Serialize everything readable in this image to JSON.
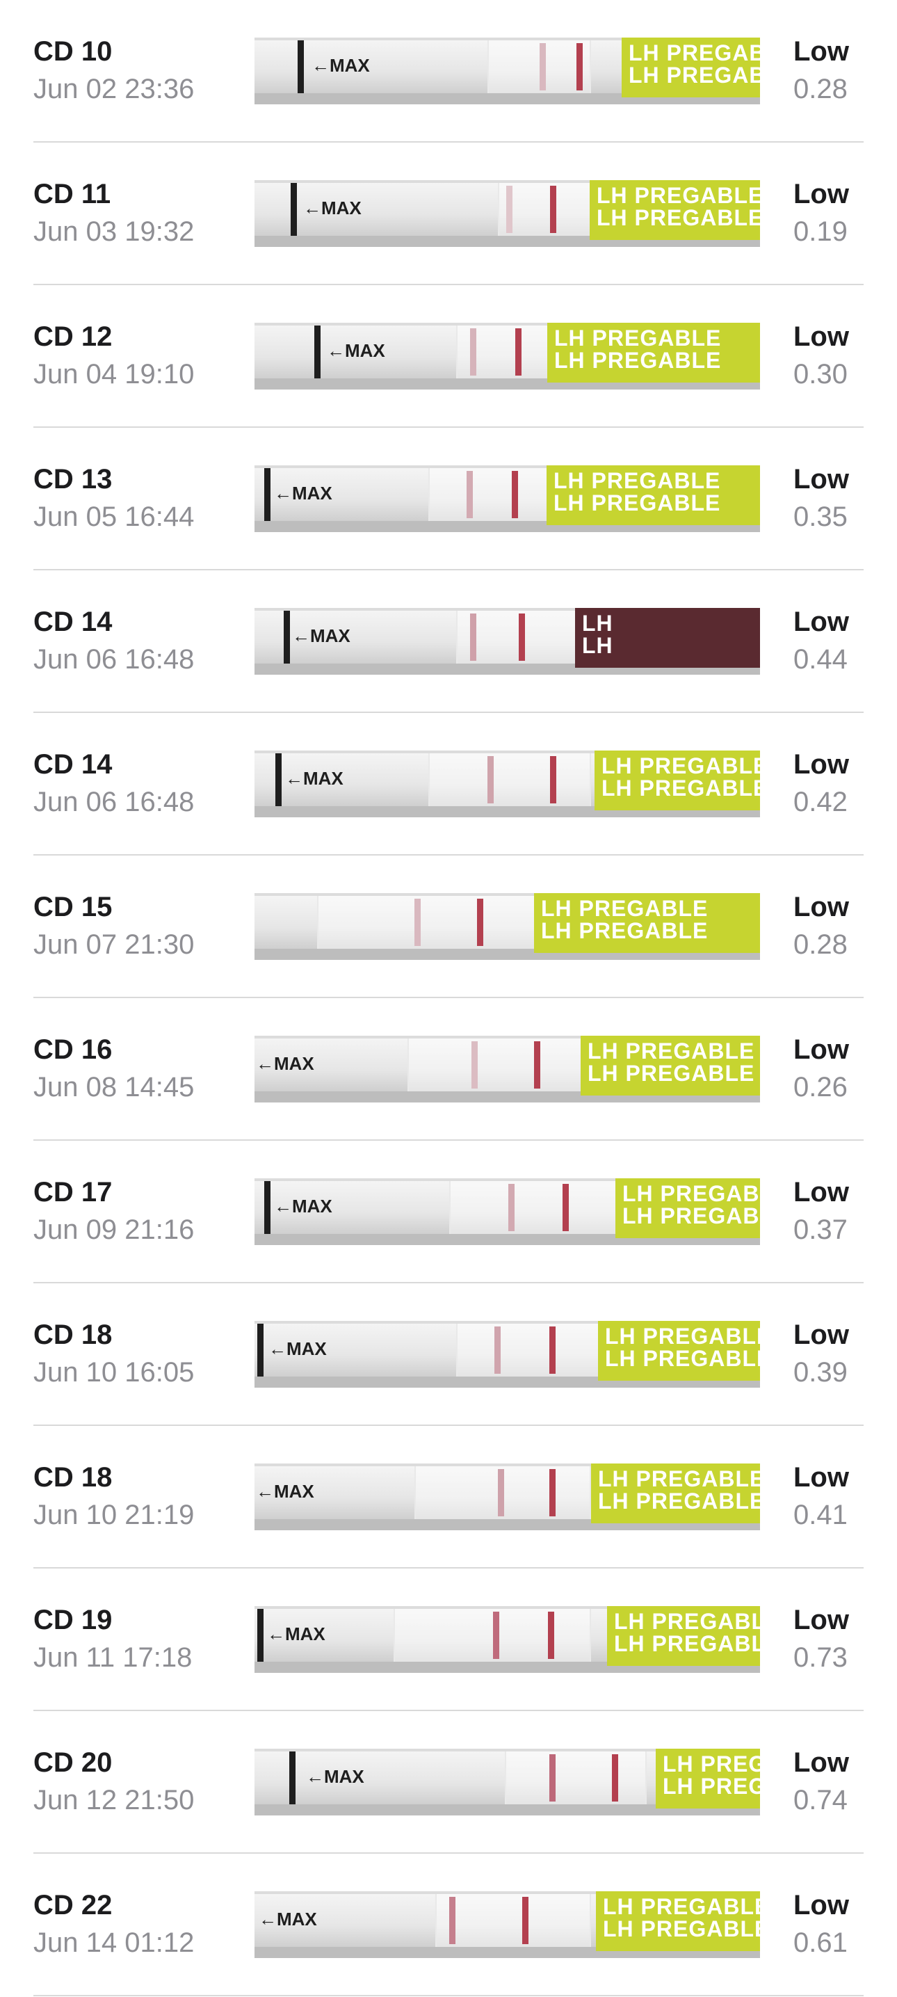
{
  "entries": [
    {
      "cd": "CD 10",
      "time": "Jun 02 23:36",
      "level": "Low",
      "ratio": "0.28",
      "strip": {
        "max": "←MAX",
        "brand": "LH PREGABLE",
        "brand_color": "#c6d430",
        "control": "#b3404f",
        "test": "#d9b8bf",
        "test_strength": 0.3
      }
    },
    {
      "cd": "CD 11",
      "time": "Jun 03 19:32",
      "level": "Low",
      "ratio": "0.19",
      "strip": {
        "max": "←MAX",
        "brand": "LH PREGABLE",
        "brand_color": "#c6d430",
        "control": "#b3404f",
        "test": "#e0c6cb",
        "test_strength": 0.2
      }
    },
    {
      "cd": "CD 12",
      "time": "Jun 04 19:10",
      "level": "Low",
      "ratio": "0.30",
      "strip": {
        "max": "←MAX",
        "brand": "LH PREGABLE",
        "brand_color": "#c6d430",
        "control": "#b3404f",
        "test": "#d6b3ba",
        "test_strength": 0.3
      }
    },
    {
      "cd": "CD 13",
      "time": "Jun 05 16:44",
      "level": "Low",
      "ratio": "0.35",
      "strip": {
        "max": "←MAX",
        "brand": "LH PREGABLE",
        "brand_color": "#c6d430",
        "control": "#b3404f",
        "test": "#d3aab2",
        "test_strength": 0.35
      }
    },
    {
      "cd": "CD 14",
      "time": "Jun 06 16:48",
      "level": "Low",
      "ratio": "0.44",
      "strip": {
        "max": "←MAX",
        "brand": "LH",
        "brand_color": "#5a2a30",
        "control": "#b3404f",
        "test": "#cfa0a9",
        "test_strength": 0.44
      }
    },
    {
      "cd": "CD 14",
      "time": "Jun 06 16:48",
      "level": "Low",
      "ratio": "0.42",
      "strip": {
        "max": "←MAX",
        "brand": "LH PREGABLE",
        "brand_color": "#c6d430",
        "control": "#b3404f",
        "test": "#cfa3ab",
        "test_strength": 0.42
      }
    },
    {
      "cd": "CD 15",
      "time": "Jun 07 21:30",
      "level": "Low",
      "ratio": "0.28",
      "strip": {
        "max": "",
        "brand": "LH PREGABLE",
        "brand_color": "#c6d430",
        "control": "#b3404f",
        "test": "#d9b8bf",
        "test_strength": 0.28
      }
    },
    {
      "cd": "CD 16",
      "time": "Jun 08 14:45",
      "level": "Low",
      "ratio": "0.26",
      "strip": {
        "max": "←MAX",
        "brand": "LH PREGABLE",
        "brand_color": "#c6d430",
        "control": "#b3404f",
        "test": "#dbbcc2",
        "test_strength": 0.26
      }
    },
    {
      "cd": "CD 17",
      "time": "Jun 09 21:16",
      "level": "Low",
      "ratio": "0.37",
      "strip": {
        "max": "←MAX",
        "brand": "LH PREGABLE",
        "brand_color": "#c6d430",
        "control": "#b3404f",
        "test": "#d2a9b1",
        "test_strength": 0.37
      }
    },
    {
      "cd": "CD 18",
      "time": "Jun 10 16:05",
      "level": "Low",
      "ratio": "0.39",
      "strip": {
        "max": "←MAX",
        "brand": "LH PREGABLE",
        "brand_color": "#c6d430",
        "control": "#b3404f",
        "test": "#d0a4ad",
        "test_strength": 0.39
      }
    },
    {
      "cd": "CD 18",
      "time": "Jun 10 21:19",
      "level": "Low",
      "ratio": "0.41",
      "strip": {
        "max": "←MAX",
        "brand": "LH PREGABLE",
        "brand_color": "#c6d430",
        "control": "#b3404f",
        "test": "#cea1aa",
        "test_strength": 0.41
      }
    },
    {
      "cd": "CD 19",
      "time": "Jun 11 17:18",
      "level": "Low",
      "ratio": "0.73",
      "strip": {
        "max": "←MAX",
        "brand": "LH PREGABLE",
        "brand_color": "#c6d430",
        "control": "#b3404f",
        "test": "#bf6b7c",
        "test_strength": 0.73
      }
    },
    {
      "cd": "CD 20",
      "time": "Jun 12 21:50",
      "level": "Low",
      "ratio": "0.74",
      "strip": {
        "max": "←MAX",
        "brand": "LH PREGABLE",
        "brand_color": "#c6d430",
        "control": "#b3404f",
        "test": "#bd6879",
        "test_strength": 0.74
      }
    },
    {
      "cd": "CD 22",
      "time": "Jun 14 01:12",
      "level": "Low",
      "ratio": "0.61",
      "strip": {
        "max": "←MAX",
        "brand": "LH PREGABLE",
        "brand_color": "#c6d430",
        "control": "#b3404f",
        "test": "#c57f8d",
        "test_strength": 0.61
      }
    }
  ]
}
